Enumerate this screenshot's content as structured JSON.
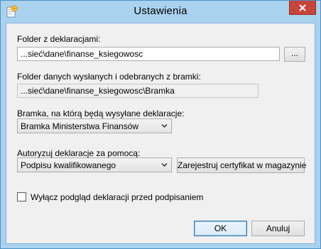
{
  "window": {
    "title": "Ustawienia"
  },
  "folder_declarations": {
    "label": "Folder z deklaracjami:",
    "value": "...sieć\\dane\\finanse_ksiegowosc",
    "browse_label": "..."
  },
  "folder_sent": {
    "label": "Folder danych wysłanych i odebranych z bramki:",
    "value": "...sieć\\dane\\finanse_ksiegowosc\\Bramka"
  },
  "gateway": {
    "label": "Bramka, na którą będą wysyłane deklaracje:",
    "selected": "Bramka Ministerstwa Finansów"
  },
  "authorize": {
    "label": "Autoryzuj deklaracje za pomocą:",
    "selected": "Podpisu kwalifikowanego",
    "register_button": "Zarejestruj certyfikat w magazynie"
  },
  "disable_preview": {
    "label": "Wyłącz podgląd deklaracji przed podpisaniem",
    "checked": false
  },
  "buttons": {
    "ok": "OK",
    "cancel": "Anuluj"
  }
}
